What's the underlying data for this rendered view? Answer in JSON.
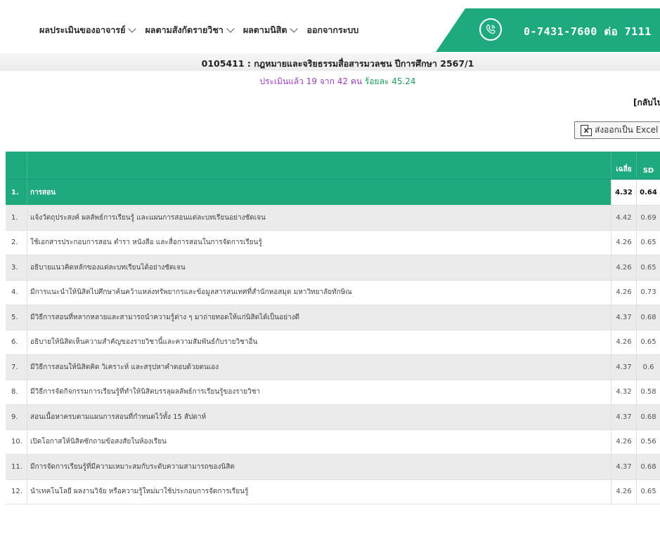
{
  "navbar": {
    "menu": [
      {
        "label": "ผลประเมินของอาจารย์",
        "has_dropdown": true
      },
      {
        "label": "ผลตามสังกัดรายวิชา",
        "has_dropdown": true
      },
      {
        "label": "ผลตามนิสิต",
        "has_dropdown": true
      },
      {
        "label": "ออกจากระบบ",
        "has_dropdown": false
      }
    ],
    "phone": "0-7431-7600 ต่อ 7111",
    "phone_icon": "phone-icon"
  },
  "course": {
    "title": "0105411 : กฎหมายและจริยธรรมสื่อสารมวลชน ปีการศึกษา 2567/1",
    "eval_prefix": "ประเมินแล้ว 19 จาก 42 คน",
    "eval_percent": "ร้อยละ 45.24"
  },
  "back_link": "[กลับไป",
  "excel_button": {
    "icon": "excel-icon",
    "icon_glyph": "x",
    "label": "ส่งออกเป็น Excel"
  },
  "table": {
    "header": {
      "num": "",
      "text": "",
      "mean": "เฉลี่ย",
      "sd": "SD"
    },
    "section": {
      "num": "1.",
      "text": "การสอน",
      "mean": "4.32",
      "sd": "0.64"
    },
    "rows": [
      {
        "num": "1.",
        "text": "แจ้งวัตถุประสงค์ ผลลัพธ์การเรียนรู้ และแผนการสอนแต่ละบทเรียนอย่างชัดเจน",
        "mean": "4.42",
        "sd": "0.69"
      },
      {
        "num": "2.",
        "text": "ใช้เอกสารประกอบการสอน ตำรา หนังสือ และสื่อการสอนในการจัดการเรียนรู้",
        "mean": "4.26",
        "sd": "0.65"
      },
      {
        "num": "3.",
        "text": "อธิบายแนวคิดหลักของแต่ละบทเรียนได้อย่างชัดเจน",
        "mean": "4.26",
        "sd": "0.65"
      },
      {
        "num": "4.",
        "text": "มีการแนะนำให้นิสิตไปศึกษาค้นคว้าแหล่งทรัพยากรและข้อมูลสารสนเทศที่สำนักหอสมุด มหาวิทยาลัยทักษิณ",
        "mean": "4.26",
        "sd": "0.73"
      },
      {
        "num": "5.",
        "text": "มีวิธีการสอนที่หลากหลายและสามารถนำความรู้ต่าง ๆ มาถ่ายทอดให้แก่นิสิตได้เป็นอย่างดี",
        "mean": "4.37",
        "sd": "0.68"
      },
      {
        "num": "6.",
        "text": "อธิบายให้นิสิตเห็นความสำคัญของรายวิชานี้และความสัมพันธ์กับรายวิชาอื่น",
        "mean": "4.26",
        "sd": "0.65"
      },
      {
        "num": "7.",
        "text": "มีวิธีการสอนให้นิสิตคิด วิเคราะห์ และสรุปหาคำตอบด้วยตนเอง",
        "mean": "4.37",
        "sd": "0.6"
      },
      {
        "num": "8.",
        "text": "มีวิธีการจัดกิจกรรมการเรียนรู้ที่ทำให้นิสิตบรรลุผลลัพธ์การเรียนรู้ของรายวิชา",
        "mean": "4.32",
        "sd": "0.58"
      },
      {
        "num": "9.",
        "text": "สอนเนื้อหาครบตามแผนการสอนที่กำหนดไว้ทั้ง 15 สัปดาห์",
        "mean": "4.37",
        "sd": "0.68"
      },
      {
        "num": "10.",
        "text": "เปิดโอกาสให้นิสิตซักถามข้อสงสัยในห้องเรียน",
        "mean": "4.26",
        "sd": "0.56"
      },
      {
        "num": "11.",
        "text": "มีการจัดการเรียนรู้ที่มีความเหมาะสมกับระดับความสามารถของนิสิต",
        "mean": "4.37",
        "sd": "0.68"
      },
      {
        "num": "12.",
        "text": "นำเทคโนโลยี ผลงานวิจัย หรือความรู้ใหม่มาใช้ประกอบการจัดการเรียนรู้",
        "mean": "4.26",
        "sd": "0.65"
      }
    ]
  },
  "colors": {
    "accent": "#1faa7e",
    "eval_purple": "#9b3fbf",
    "eval_green": "#1f9a5a"
  }
}
